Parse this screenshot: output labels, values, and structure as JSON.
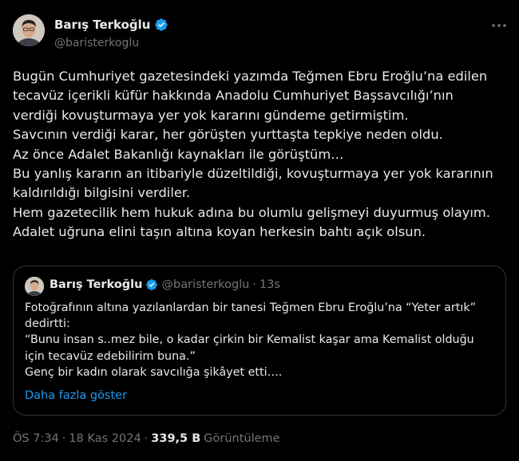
{
  "author": {
    "name": "Barış Terkoğlu",
    "handle": "@baristerkoglu",
    "verified_color": "#1d9bf0"
  },
  "more_icon": "more-horizontal-icon",
  "tweet": {
    "lines": [
      "Bugün Cumhuriyet gazetesindeki yazımda Teğmen Ebru Eroğlu’na edilen",
      "tecavüz içerikli küfür hakkında Anadolu Cumhuriyet Başsavcılığı’nın",
      "verdiği kovuşturmaya yer yok kararını gündeme getirmiştim.",
      "Savcının verdiği karar, her görüşten yurttaşta tepkiye neden oldu.",
      "Az önce Adalet Bakanlığı kaynakları ile görüştüm…",
      "Bu yanlış kararın an itibariyle düzeltildiği, kovuşturmaya yer yok kararının",
      "kaldırıldığı bilgisini verdiler.",
      "Hem gazetecilik hem hukuk adına bu olumlu gelişmeyi duyurmuş olayım.",
      "Adalet uğruna elini taşın altına koyan herkesin bahtı açık olsun."
    ]
  },
  "quote": {
    "name": "Barış Terkoğlu",
    "handle": "@baristerkoglu",
    "dot": "·",
    "time": "13s",
    "lines": [
      "Fotoğrafının altına yazılanlardan bir tanesi Teğmen Ebru Eroğlu’na “Yeter artık”",
      "dedirtti:",
      "“Bunu insan s..mez bile, o kadar çirkin bir Kemalist kaşar ama Kemalist olduğu",
      "için tecavüz edebilirim buna.”",
      "Genç bir kadın olarak savcılığa şikâyet etti…."
    ],
    "show_more": "Daha fazla göster"
  },
  "meta": {
    "time": "ÖS 7:34",
    "sep1": "·",
    "date": "18 Kas 2024",
    "sep2": "·",
    "views": "339,5 B",
    "views_label": "Görüntüleme"
  },
  "colors": {
    "background": "#000000",
    "text": "#e7e9ea",
    "secondary": "#71767b",
    "link": "#1d9bf0",
    "border": "#2f3336"
  }
}
